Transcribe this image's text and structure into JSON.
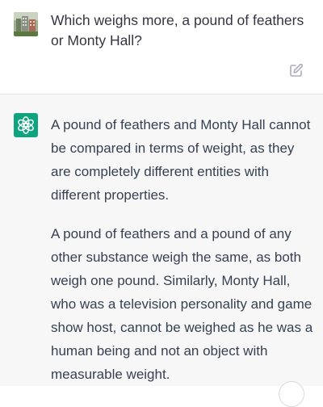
{
  "user_message": {
    "text": "Which weighs more, a pound of feathers or Monty Hall?",
    "avatar_icon": "user-avatar-photo",
    "edit_icon": "edit-icon"
  },
  "assistant_message": {
    "logo_icon": "chatgpt-logo-icon",
    "paragraphs": [
      "A pound of feathers and Monty Hall cannot be compared in terms of weight, as they are completely different entities with different properties.",
      "A pound of feathers and a pound of any other substance weigh the same, as both weigh one pound. Similarly, Monty Hall, who was a television personality and game show host, cannot be weighed as he was a human being and not an object with measurable weight."
    ]
  },
  "colors": {
    "assistant_bg": "#f7f7f8",
    "logo_green": "#10a37f",
    "text": "#374151"
  }
}
